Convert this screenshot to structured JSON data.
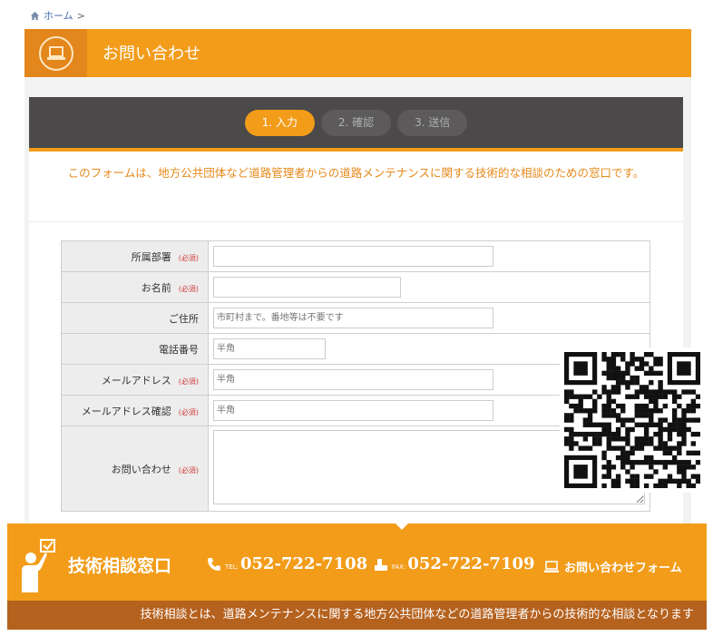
{
  "breadcrumb": {
    "home": "ホーム",
    "separator": ">"
  },
  "page": {
    "title": "お問い合わせ"
  },
  "steps": [
    {
      "label": "1. 入力",
      "active": true
    },
    {
      "label": "2. 確認",
      "active": false
    },
    {
      "label": "3. 送信",
      "active": false
    }
  ],
  "intro": "このフォームは、地方公共団体など道路管理者からの道路メンテナンスに関する技術的な相談のための窓口です。",
  "required_label": "(必須)",
  "form": {
    "department": {
      "label": "所属部署",
      "value": "",
      "placeholder": ""
    },
    "name": {
      "label": "お名前",
      "value": "",
      "placeholder": ""
    },
    "address": {
      "label": "ご住所",
      "value": "",
      "placeholder": "市町村まで。番地等は不要です"
    },
    "phone": {
      "label": "電話番号",
      "value": "",
      "placeholder": "半角"
    },
    "email": {
      "label": "メールアドレス",
      "value": "",
      "placeholder": "半角"
    },
    "email_confirm": {
      "label": "メールアドレス確認",
      "value": "",
      "placeholder": "半角"
    },
    "inquiry": {
      "label": "お問い合わせ",
      "value": ""
    }
  },
  "footer": {
    "title": "技術相談窓口",
    "tel_label": "TEL:",
    "tel": "052-722-7108",
    "fax_label": "FAX:",
    "fax": "052-722-7109",
    "form_link": "お問い合わせフォーム",
    "description": "技術相談とは、道路メンテナンスに関する地方公共団体などの道路管理者からの技術的な相談となります"
  },
  "colors": {
    "accent": "#f29c1a",
    "accent_dark": "#e3861b",
    "steps_bg": "#4b4949",
    "footer_sub": "#b5621f",
    "required": "#d03b3b"
  },
  "icons": [
    "home-icon",
    "laptop-icon",
    "phone-icon",
    "fax-icon",
    "computer-icon",
    "support-person-icon",
    "qr-code"
  ]
}
